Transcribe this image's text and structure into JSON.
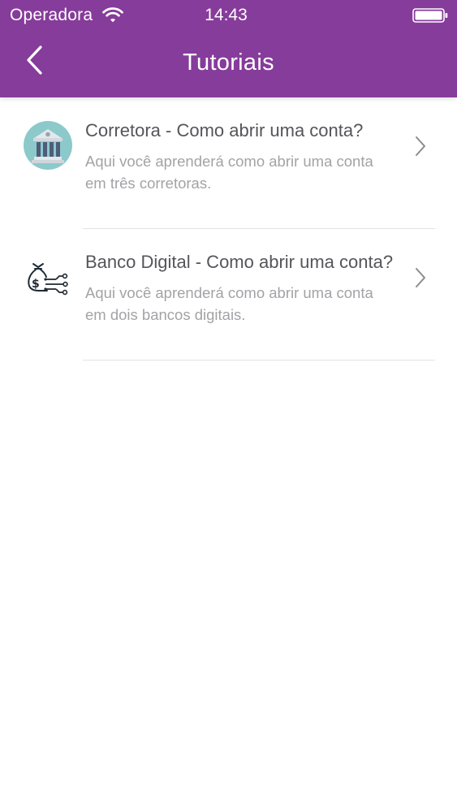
{
  "status_bar": {
    "carrier": "Operadora",
    "time": "14:43",
    "wifi_icon": "wifi-icon",
    "battery_icon": "battery-icon"
  },
  "nav": {
    "title": "Tutoriais",
    "back_icon": "chevron-left-icon",
    "background_color": "#863c9a"
  },
  "tutorials": [
    {
      "icon": "bank-icon",
      "title": "Corretora - Como abrir uma conta?",
      "description": "Aqui você aprenderá como abrir uma conta em três corretoras."
    },
    {
      "icon": "money-bag-digital-icon",
      "title": "Banco Digital - Como abrir uma conta?",
      "description": "Aqui você aprenderá como abrir uma conta em dois bancos digitais."
    }
  ]
}
